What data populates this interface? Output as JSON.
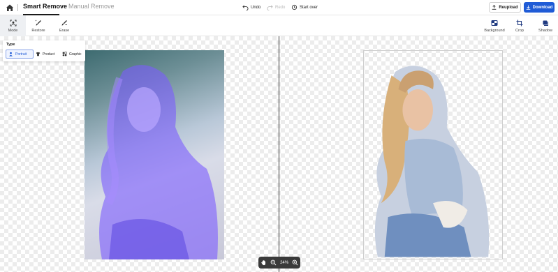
{
  "header": {
    "tabs": [
      {
        "label": "Smart Remove",
        "active": true
      },
      {
        "label": "Manual Remove",
        "active": false
      }
    ],
    "history": {
      "undo": "Undo",
      "redo": "Redo",
      "start_over": "Start over"
    },
    "reupload_label": "Reupload",
    "download_label": "Download"
  },
  "toolbar": {
    "left": [
      {
        "label": "Mode",
        "icon": "mode-icon",
        "active": true
      },
      {
        "label": "Restore",
        "icon": "restore-brush-icon"
      },
      {
        "label": "Erase",
        "icon": "erase-brush-icon"
      }
    ],
    "right": [
      {
        "label": "Background",
        "icon": "background-icon"
      },
      {
        "label": "Crop",
        "icon": "crop-icon"
      },
      {
        "label": "Shadow",
        "icon": "shadow-icon"
      }
    ]
  },
  "type_panel": {
    "title": "Type",
    "options": [
      {
        "label": "Portrait",
        "icon": "person-icon",
        "selected": true
      },
      {
        "label": "Product",
        "icon": "shirt-icon",
        "selected": false
      },
      {
        "label": "Graphic",
        "icon": "graphic-icon",
        "selected": false
      }
    ]
  },
  "zoom": {
    "value": "24%"
  },
  "colors": {
    "accent": "#1f5bd6",
    "overlay": "#7b5cff",
    "zoombar": "#3a3a3a"
  }
}
